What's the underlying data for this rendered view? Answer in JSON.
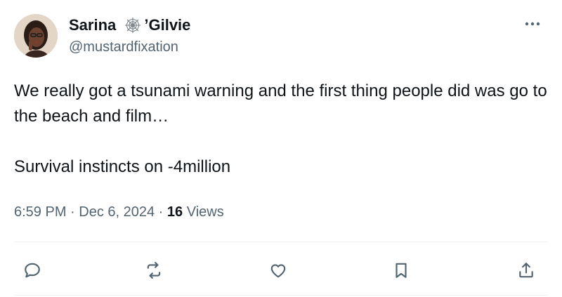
{
  "author": {
    "name_before_emoji": "Sarina ",
    "name_emoji_icon": "spiderweb-icon",
    "name_after_emoji": "’Gilvie",
    "handle": "@mustardfixation"
  },
  "tweet": {
    "text": "We really got a tsunami warning and the first thing people did was go to the beach and film…\n\nSurvival instincts on -4million",
    "time": "6:59 PM",
    "separator": " · ",
    "date": "Dec 6, 2024",
    "views_count": "16",
    "views_label": " Views"
  },
  "actions": [
    {
      "name": "reply",
      "icon": "speech-bubble-icon"
    },
    {
      "name": "repost",
      "icon": "repost-arrows-icon"
    },
    {
      "name": "like",
      "icon": "heart-icon"
    },
    {
      "name": "bookmark",
      "icon": "bookmark-icon"
    },
    {
      "name": "share",
      "icon": "share-icon"
    }
  ],
  "colors": {
    "text_primary": "#0f1419",
    "text_secondary": "#536471",
    "divider": "#eff3f4",
    "background": "#ffffff"
  }
}
